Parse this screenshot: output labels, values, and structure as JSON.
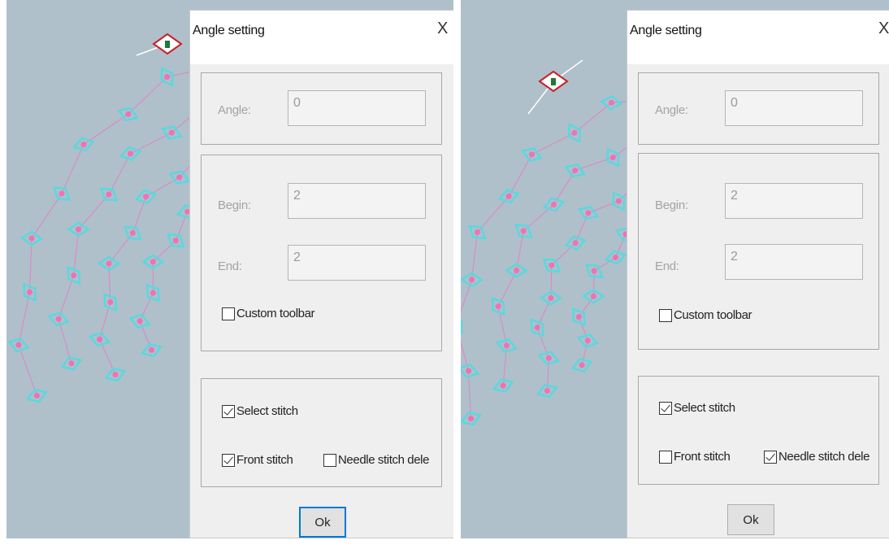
{
  "left_dialog": {
    "title": "Angle setting",
    "close": "X",
    "angle_label": "Angle:",
    "angle_value": "0",
    "begin_label": "Begin:",
    "begin_value": "2",
    "end_label": "End:",
    "end_value": "2",
    "custom_toolbar": {
      "label": "Custom toolbar",
      "checked": false
    },
    "select_stitch": {
      "label": "Select stitch",
      "checked": true
    },
    "front_stitch": {
      "label": "Front stitch",
      "checked": true
    },
    "needle_stitch_delete": {
      "label": "Needle stitch dele",
      "checked": false
    },
    "ok": "Ok"
  },
  "right_dialog": {
    "title": "Angle setting",
    "close": "X",
    "angle_label": "Angle:",
    "angle_value": "0",
    "begin_label": "Begin:",
    "begin_value": "2",
    "end_label": "End:",
    "end_value": "2",
    "custom_toolbar": {
      "label": "Custom toolbar",
      "checked": false
    },
    "select_stitch": {
      "label": "Select stitch",
      "checked": true
    },
    "front_stitch": {
      "label": "Front stitch",
      "checked": false
    },
    "needle_stitch_delete": {
      "label": "Needle stitch dele",
      "checked": true
    },
    "ok": "Ok"
  },
  "colors": {
    "canvas_bg": "#afc0ca",
    "stitch_marker": "#5ad8de",
    "stitch_point": "#ee72b4",
    "stitch_line": "#d98cc4",
    "selected_marker": "#c8202a",
    "selected_point": "#1e7a3a",
    "ok_focus": "#0078d7"
  }
}
